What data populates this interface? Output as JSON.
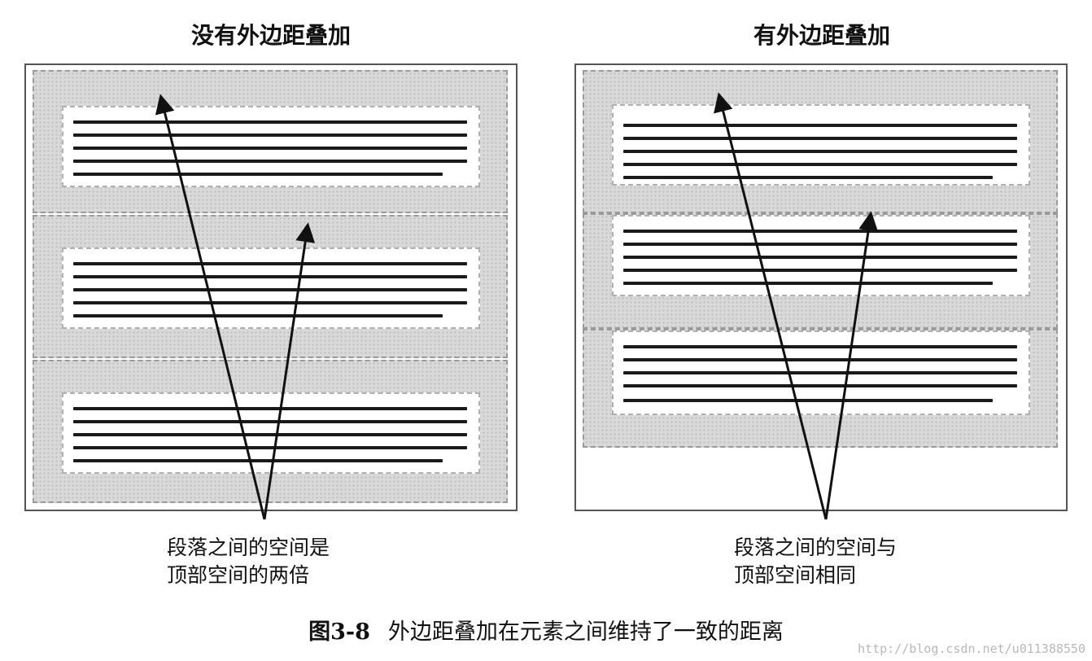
{
  "panels": [
    {
      "title": "没有外边距叠加",
      "caption_lines": [
        "段落之间的空间是",
        "顶部空间的两倍"
      ]
    },
    {
      "title": "有外边距叠加",
      "caption_lines": [
        "段落之间的空间与",
        "顶部空间相同"
      ]
    }
  ],
  "figure_caption": {
    "number": "图3-8",
    "text": "外边距叠加在元素之间维持了一致的距离"
  },
  "watermark": "http://blog.csdn.net/u011388550",
  "colors": {
    "margin_fill": "#d9d9d9",
    "frame_border": "#555555",
    "text_line": "#1a1a1a",
    "arrow": "#111111"
  }
}
